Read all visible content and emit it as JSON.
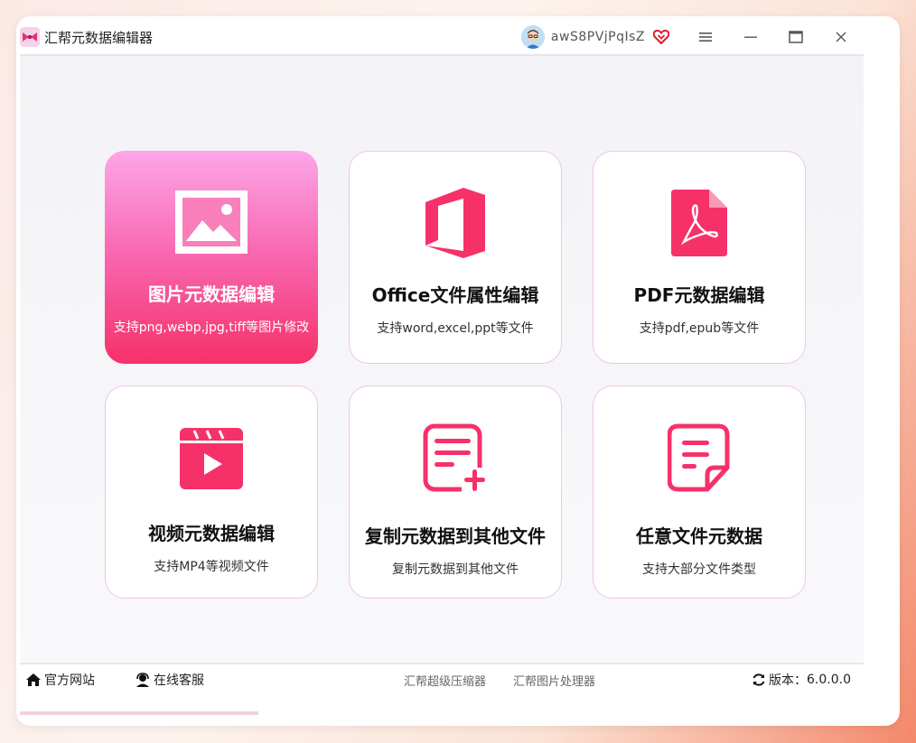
{
  "app": {
    "title": "汇帮元数据编辑器",
    "username": "awS8PVjPqIsZ"
  },
  "window_icons": [
    "menu-icon",
    "minimize-icon",
    "maximize-icon",
    "close-icon"
  ],
  "colors": {
    "accent": "#f6316a",
    "pink_light": "#fda6e8",
    "card_border": "#f1c2ea"
  },
  "cards": [
    {
      "title": "图片元数据编辑",
      "subtitle": "支持png,webp,jpg,tiff等图片修改",
      "icon": "image-icon",
      "active": true
    },
    {
      "title": "Office文件属性编辑",
      "subtitle": "支持word,excel,ppt等文件",
      "icon": "office-icon",
      "active": false
    },
    {
      "title": "PDF元数据编辑",
      "subtitle": "支持pdf,epub等文件",
      "icon": "pdf-icon",
      "active": false
    },
    {
      "title": "视频元数据编辑",
      "subtitle": "支持MP4等视频文件",
      "icon": "video-icon",
      "active": false
    },
    {
      "title": "复制元数据到其他文件",
      "subtitle": "复制元数据到其他文件",
      "icon": "add-document-icon",
      "active": false
    },
    {
      "title": "任意文件元数据",
      "subtitle": "支持大部分文件类型",
      "icon": "document-icon",
      "active": false
    }
  ],
  "footer": {
    "website": "官方网站",
    "support": "在线客服",
    "link_compressor": "汇帮超级压缩器",
    "link_image_processor": "汇帮图片处理器",
    "version_label": "版本：",
    "version": "6.0.0.0"
  }
}
